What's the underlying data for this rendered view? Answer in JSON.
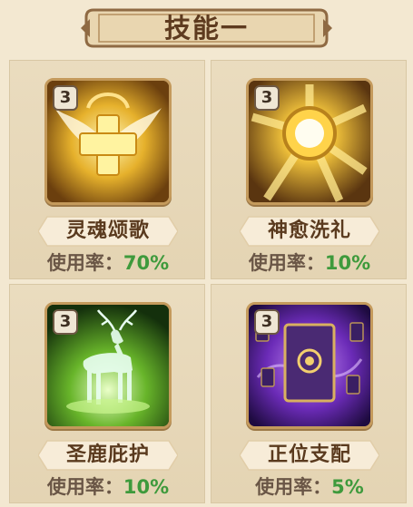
{
  "header": {
    "title": "技能一"
  },
  "skills": [
    {
      "level": "3",
      "name": "灵魂颂歌",
      "usage_label": "使用率：",
      "usage_value": "70%",
      "icon": "holy-cross-wings-icon"
    },
    {
      "level": "3",
      "name": "神愈洗礼",
      "usage_label": "使用率：",
      "usage_value": "10%",
      "icon": "radiant-sun-icon"
    },
    {
      "level": "3",
      "name": "圣鹿庇护",
      "usage_label": "使用率：",
      "usage_value": "10%",
      "icon": "spirit-deer-icon"
    },
    {
      "level": "3",
      "name": "正位支配",
      "usage_label": "使用率：",
      "usage_value": "5%",
      "icon": "tarot-card-icon"
    }
  ],
  "colors": {
    "usage_value": "#3e9a3c",
    "frame": "#c49a5c",
    "title": "#5e3b1f"
  }
}
